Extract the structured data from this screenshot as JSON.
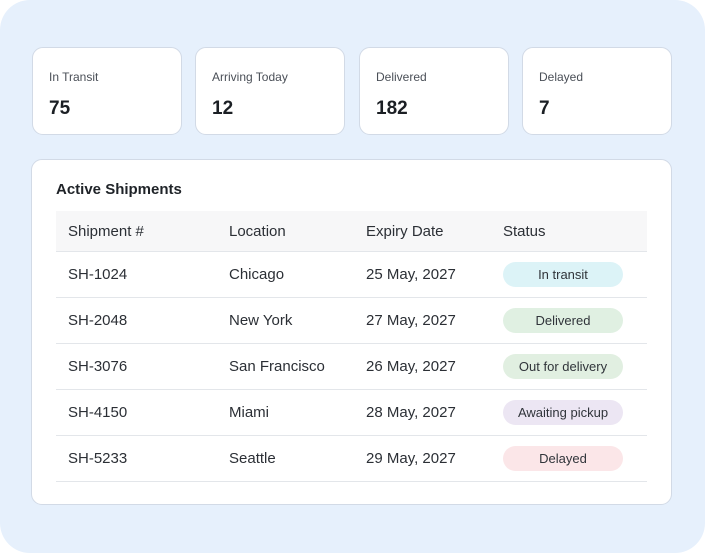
{
  "stats": [
    {
      "label": "In Transit",
      "value": "75"
    },
    {
      "label": "Arriving Today",
      "value": "12"
    },
    {
      "label": "Delivered",
      "value": "182"
    },
    {
      "label": "Delayed",
      "value": "7"
    }
  ],
  "panel": {
    "title": "Active Shipments"
  },
  "table": {
    "headers": [
      "Shipment #",
      "Location",
      "Expiry Date",
      "Status"
    ],
    "rows": [
      {
        "id": "SH-1024",
        "location": "Chicago",
        "date": "25 May, 2027",
        "status": "In transit",
        "status_color": "#dcf3f7"
      },
      {
        "id": "SH-2048",
        "location": "New York",
        "date": "27 May, 2027",
        "status": "Delivered",
        "status_color": "#e0f0e2"
      },
      {
        "id": "SH-3076",
        "location": "San Francisco",
        "date": "26 May, 2027",
        "status": "Out for delivery",
        "status_color": "#e1efe1"
      },
      {
        "id": "SH-4150",
        "location": "Miami",
        "date": "28 May, 2027",
        "status": "Awaiting pickup",
        "status_color": "#ece6f3"
      },
      {
        "id": "SH-5233",
        "location": "Seattle",
        "date": "29 May, 2027",
        "status": "Delayed",
        "status_color": "#fbe6e8"
      }
    ]
  },
  "colors": {
    "page_background": "#e6f0fc",
    "card_background": "#ffffff",
    "card_border": "#d2dae6"
  }
}
